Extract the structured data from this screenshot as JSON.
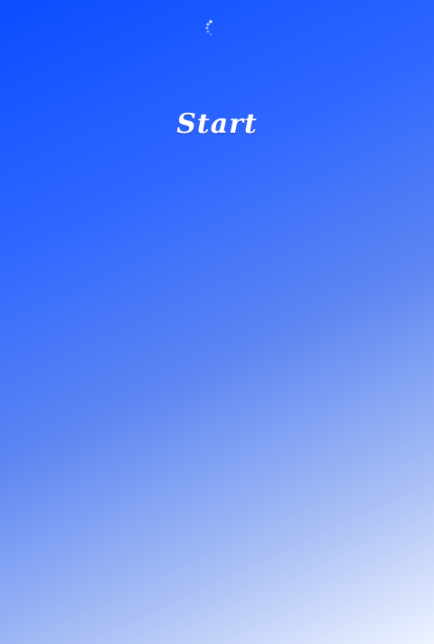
{
  "screen": {
    "title": "Start",
    "loading_icon": "loading-spinner-icon"
  },
  "colors": {
    "gradient_top_left": "#0a4cff",
    "gradient_bottom_right": "#eef3ff",
    "title_text": "#ffffff"
  }
}
